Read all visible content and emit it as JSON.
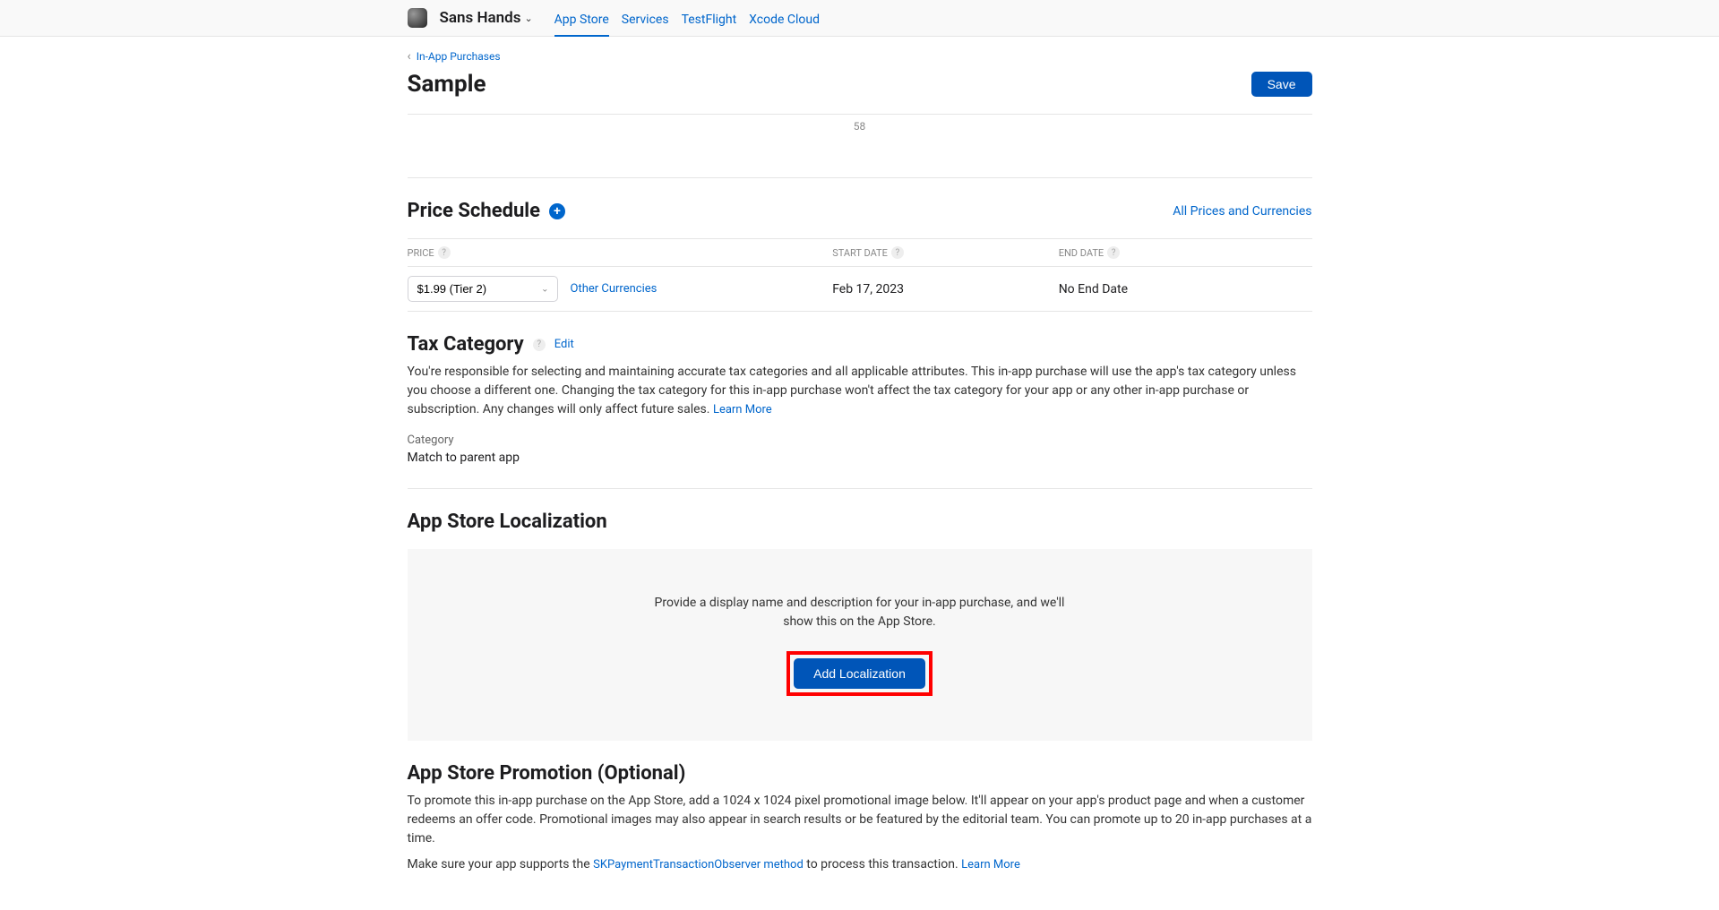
{
  "header": {
    "app_name": "Sans Hands",
    "tabs": {
      "app_store": "App Store",
      "services": "Services",
      "testflight": "TestFlight",
      "xcode_cloud": "Xcode Cloud"
    }
  },
  "breadcrumb": {
    "label": "In-App Purchases"
  },
  "page": {
    "title": "Sample",
    "save_label": "Save",
    "counter": "58"
  },
  "price_schedule": {
    "title": "Price Schedule",
    "all_prices_link": "All Prices and Currencies",
    "columns": {
      "price": "PRICE",
      "start_date": "START DATE",
      "end_date": "END DATE"
    },
    "row": {
      "price_value": "$1.99 (Tier 2)",
      "other_currencies": "Other Currencies",
      "start_date": "Feb 17, 2023",
      "end_date": "No End Date"
    }
  },
  "tax_category": {
    "title": "Tax Category",
    "edit_label": "Edit",
    "description": "You're responsible for selecting and maintaining accurate tax categories and all applicable attributes. This in-app purchase will use the app's tax category unless you choose a different one. Changing the tax category for this in-app purchase won't affect the tax category for your app or any other in-app purchase or subscription. Any changes will only affect future sales. ",
    "learn_more": "Learn More",
    "category_label": "Category",
    "category_value": "Match to parent app"
  },
  "localization": {
    "title": "App Store Localization",
    "description": "Provide a display name and description for your in-app purchase, and we'll show this on the App Store.",
    "button_label": "Add Localization"
  },
  "promotion": {
    "title": "App Store Promotion (Optional)",
    "description": "To promote this in-app purchase on the App Store, add a 1024 x 1024 pixel promotional image below. It'll appear on your app's product page and when a customer redeems an offer code. Promotional images may also appear in search results or be featured by the editorial team. You can promote up to 20 in-app purchases at a time.",
    "support_text_before": "Make sure your app supports the ",
    "support_link": "SKPaymentTransactionObserver method",
    "support_text_after": " to process this transaction. ",
    "learn_more": "Learn More"
  }
}
